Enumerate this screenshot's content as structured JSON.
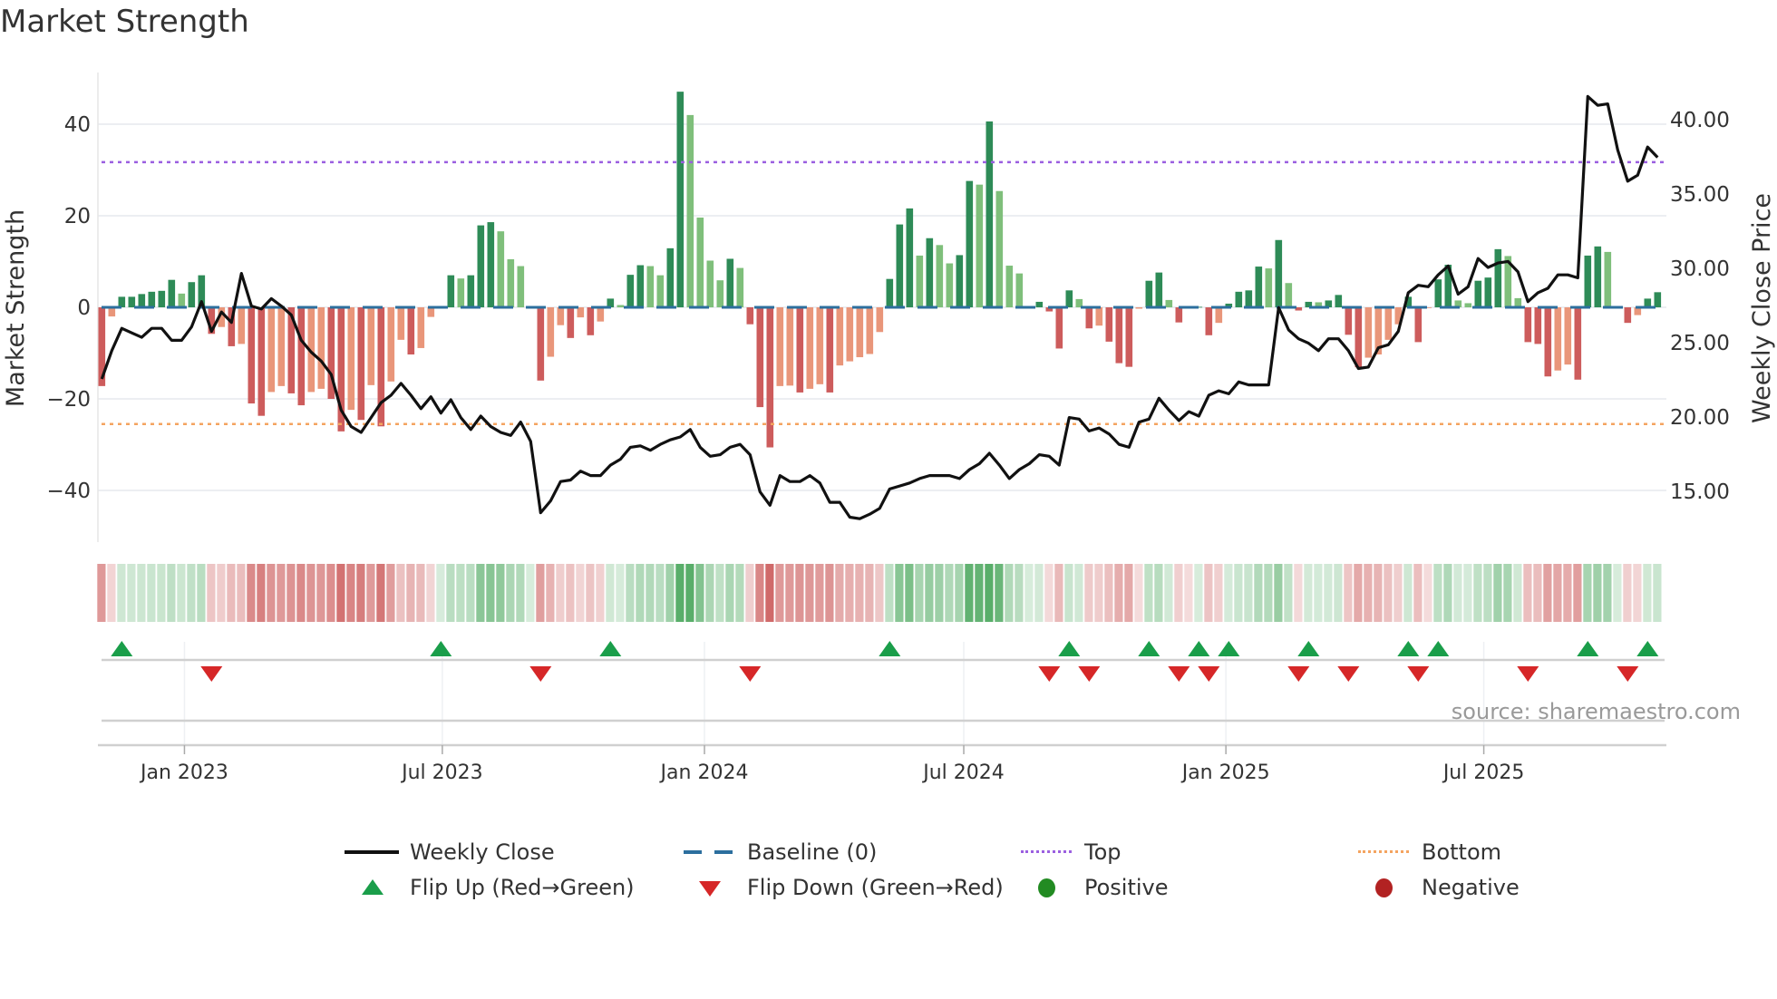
{
  "title": "Market Strength",
  "source": "source: sharemaestro.com",
  "colors": {
    "strength_up_strong": "#2e8b57",
    "strength_up_weak": "#7fbf7b",
    "strength_down_strong": "#cd5c5c",
    "strength_down_weak": "#e9967a",
    "weekly_close": "#111111",
    "baseline": "#2c6f9e",
    "top": "#9b5fe0",
    "bottom": "#f4a460",
    "flip_up": "#1a9e4a",
    "flip_down": "#d62728",
    "positive": "#228b22",
    "negative": "#b22222"
  },
  "legend": [
    {
      "label": "Weekly Close",
      "symbol": "solid-line"
    },
    {
      "label": "Baseline (0)",
      "symbol": "dashed-line"
    },
    {
      "label": "Top",
      "symbol": "dotted-line"
    },
    {
      "label": "Bottom",
      "symbol": "dotted-line"
    },
    {
      "label": "Flip Up (Red→Green)",
      "symbol": "triangle-up"
    },
    {
      "label": "Flip Down (Green→Red)",
      "symbol": "triangle-down"
    },
    {
      "label": "Positive",
      "symbol": "circle"
    },
    {
      "label": "Negative",
      "symbol": "circle"
    }
  ],
  "chart_data": {
    "type": "bar",
    "title": "Market Strength",
    "ylabel": "Market Strength",
    "y2label": "Weekly Close Price",
    "ylim": [
      -51,
      52
    ],
    "y2lim": [
      11.5,
      43
    ],
    "yticks": [
      40,
      20,
      0,
      -20,
      -40
    ],
    "ytick_labels": [
      "40",
      "20",
      "0",
      "−20",
      "−40"
    ],
    "y2ticks": [
      40,
      35,
      30,
      25,
      20,
      15
    ],
    "y2tick_labels": [
      "40.00",
      "35.00",
      "30.00",
      "25.00",
      "20.00",
      "15.00"
    ],
    "xticks": [
      "2023-01-01",
      "2023-07-01",
      "2024-01-01",
      "2024-07-01",
      "2025-01-01",
      "2025-07-01"
    ],
    "xtick_labels": [
      "Jan 2023",
      "Jul 2023",
      "Jan 2024",
      "Jul 2024",
      "Jan 2025",
      "Jul 2025"
    ],
    "grid": true,
    "legend_position": "bottom",
    "top_level": 31.7,
    "bottom_level": -25.5,
    "baseline": 0,
    "dates": [
      "2022-11-04",
      "2022-11-11",
      "2022-11-18",
      "2022-11-25",
      "2022-12-02",
      "2022-12-09",
      "2022-12-16",
      "2022-12-23",
      "2022-12-30",
      "2023-01-06",
      "2023-01-13",
      "2023-01-20",
      "2023-01-27",
      "2023-02-03",
      "2023-02-10",
      "2023-02-17",
      "2023-02-24",
      "2023-03-03",
      "2023-03-10",
      "2023-03-17",
      "2023-03-24",
      "2023-03-31",
      "2023-04-07",
      "2023-04-14",
      "2023-04-21",
      "2023-04-28",
      "2023-05-05",
      "2023-05-12",
      "2023-05-19",
      "2023-05-26",
      "2023-06-02",
      "2023-06-09",
      "2023-06-16",
      "2023-06-23",
      "2023-06-30",
      "2023-07-07",
      "2023-07-14",
      "2023-07-21",
      "2023-07-28",
      "2023-08-04",
      "2023-08-11",
      "2023-08-18",
      "2023-08-25",
      "2023-09-01",
      "2023-09-08",
      "2023-09-15",
      "2023-09-22",
      "2023-09-29",
      "2023-10-06",
      "2023-10-13",
      "2023-10-20",
      "2023-10-27",
      "2023-11-03",
      "2023-11-10",
      "2023-11-17",
      "2023-11-24",
      "2023-12-01",
      "2023-12-08",
      "2023-12-15",
      "2023-12-22",
      "2023-12-29",
      "2024-01-05",
      "2024-01-12",
      "2024-01-19",
      "2024-01-26",
      "2024-02-02",
      "2024-02-09",
      "2024-02-16",
      "2024-02-23",
      "2024-03-01",
      "2024-03-08",
      "2024-03-15",
      "2024-03-22",
      "2024-03-29",
      "2024-04-05",
      "2024-04-12",
      "2024-04-19",
      "2024-04-26",
      "2024-05-03",
      "2024-05-10",
      "2024-05-17",
      "2024-05-24",
      "2024-05-31",
      "2024-06-07",
      "2024-06-14",
      "2024-06-21",
      "2024-06-28",
      "2024-07-05",
      "2024-07-12",
      "2024-07-19",
      "2024-07-26",
      "2024-08-02",
      "2024-08-09",
      "2024-08-16",
      "2024-08-23",
      "2024-08-30",
      "2024-09-06",
      "2024-09-13",
      "2024-09-20",
      "2024-09-27",
      "2024-10-04",
      "2024-10-11",
      "2024-10-18",
      "2024-10-25",
      "2024-11-01",
      "2024-11-08",
      "2024-11-15",
      "2024-11-22",
      "2024-11-29",
      "2024-12-06",
      "2024-12-13",
      "2024-12-20",
      "2024-12-27",
      "2025-01-03",
      "2025-01-10",
      "2025-01-17",
      "2025-01-24",
      "2025-01-31",
      "2025-02-07",
      "2025-02-14",
      "2025-02-21",
      "2025-02-28",
      "2025-03-07",
      "2025-03-14",
      "2025-03-21",
      "2025-03-28",
      "2025-04-04",
      "2025-04-11",
      "2025-04-18",
      "2025-04-25",
      "2025-05-02",
      "2025-05-09",
      "2025-05-16",
      "2025-05-23",
      "2025-05-30",
      "2025-06-06",
      "2025-06-13",
      "2025-06-20",
      "2025-06-27",
      "2025-07-04",
      "2025-07-11",
      "2025-07-18",
      "2025-07-25",
      "2025-08-01",
      "2025-08-08",
      "2025-08-15",
      "2025-08-22",
      "2025-08-29",
      "2025-09-05",
      "2025-09-12",
      "2025-09-19",
      "2025-09-26",
      "2025-10-03",
      "2025-10-10",
      "2025-10-17",
      "2025-10-24",
      "2025-10-31"
    ],
    "series": [
      {
        "name": "Market Strength",
        "axis": "left",
        "kind": "bar",
        "values": [
          -17.2,
          -2,
          2.3,
          2.3,
          2.9,
          3.4,
          3.6,
          6,
          3,
          5.5,
          7,
          -5.8,
          -4.3,
          -8.5,
          -8,
          -21,
          -23.7,
          -18.5,
          -17.2,
          -18.8,
          -21.4,
          -18.5,
          -17.8,
          -20,
          -27.1,
          -22.4,
          -24.6,
          -17,
          -26,
          -16.2,
          -7.1,
          -10.3,
          -8.9,
          -2.1,
          0.3,
          7,
          6.3,
          7,
          17.9,
          18.6,
          16.6,
          10.5,
          9,
          0.2,
          -16,
          -10.8,
          -3.9,
          -6.7,
          -2.2,
          -6.1,
          -3.1,
          1.9,
          0.5,
          7.1,
          9.2,
          9,
          7,
          12.9,
          47.1,
          42,
          19.6,
          10.2,
          5.9,
          10.6,
          8.6,
          -3.7,
          -21.8,
          -30.6,
          -17.2,
          -17.1,
          -18.6,
          -17.8,
          -16.8,
          -18.6,
          -12.7,
          -11.8,
          -10.9,
          -10.2,
          -5.4,
          6.2,
          18.1,
          21.6,
          11.3,
          15.1,
          13.6,
          9.6,
          11.4,
          27.6,
          26.8,
          40.6,
          25.4,
          9.1,
          7.4,
          0.1,
          1.2,
          -0.9,
          -9,
          3.7,
          1.8,
          -4.6,
          -4,
          -7.5,
          -12.2,
          -13,
          -0.3,
          5.8,
          7.6,
          1.6,
          -3.3,
          -0.1,
          0.1,
          -6.1,
          -3.4,
          0.8,
          3.4,
          3.7,
          8.9,
          8.5,
          14.7,
          5.3,
          -0.7,
          1.2,
          1.1,
          1.5,
          2.7,
          -6,
          -13.1,
          -11,
          -10.3,
          -7.1,
          -3.7,
          2.3,
          -7.6,
          -0.1,
          6.1,
          9.3,
          1.5,
          0.9,
          5.8,
          6.5,
          12.7,
          11.2,
          2,
          -7.6,
          -8,
          -15.1,
          -13.8,
          -12.5,
          -15.8,
          11.3,
          13.3,
          12.1,
          0.1,
          -3.4,
          -1.7,
          1.9,
          3.3
        ]
      },
      {
        "name": "Weekly Close",
        "axis": "right",
        "kind": "line",
        "values": [
          22.5,
          24.4,
          25.9,
          25.6,
          25.3,
          25.9,
          25.9,
          25.1,
          25.1,
          26.0,
          27.7,
          25.7,
          27.0,
          26.3,
          29.6,
          27.4,
          27.2,
          27.9,
          27.4,
          26.8,
          25.1,
          24.3,
          23.7,
          22.8,
          20.4,
          19.3,
          18.9,
          19.9,
          20.9,
          21.4,
          22.2,
          21.4,
          20.5,
          21.3,
          20.2,
          21.1,
          19.9,
          19.1,
          20.0,
          19.3,
          18.9,
          18.7,
          19.6,
          18.3,
          13.5,
          14.3,
          15.6,
          15.7,
          16.3,
          16.0,
          16.0,
          16.7,
          17.1,
          17.9,
          18.0,
          17.7,
          18.1,
          18.4,
          18.6,
          19.1,
          17.9,
          17.3,
          17.4,
          17.9,
          18.1,
          17.4,
          14.9,
          14.0,
          16.0,
          15.6,
          15.6,
          16.0,
          15.5,
          14.2,
          14.2,
          13.2,
          13.1,
          13.4,
          13.8,
          15.1,
          15.3,
          15.5,
          15.8,
          16.0,
          16.0,
          16.0,
          15.8,
          16.4,
          16.8,
          17.5,
          16.7,
          15.8,
          16.4,
          16.8,
          17.4,
          17.3,
          16.7,
          19.9,
          19.8,
          19.0,
          19.2,
          18.8,
          18.1,
          17.9,
          19.6,
          19.8,
          21.2,
          20.4,
          19.7,
          20.3,
          20.0,
          21.4,
          21.7,
          21.5,
          22.3,
          22.1,
          22.1,
          22.1,
          27.3,
          25.8,
          25.2,
          24.9,
          24.4,
          25.2,
          25.2,
          24.4,
          23.2,
          23.3,
          24.6,
          24.8,
          25.7,
          28.3,
          28.8,
          28.7,
          29.5,
          30.1,
          28.2,
          28.7,
          30.6,
          30.0,
          30.3,
          30.4,
          29.7,
          27.7,
          28.3,
          28.6,
          29.5,
          29.5,
          29.3,
          41.5,
          40.9,
          41.0,
          37.9,
          35.8,
          36.2,
          38.1,
          37.4
        ]
      }
    ],
    "flip_up": [
      "2022-11-18",
      "2023-06-30",
      "2023-10-27",
      "2024-05-10",
      "2024-09-13",
      "2024-11-08",
      "2024-12-13",
      "2025-01-03",
      "2025-02-28",
      "2025-05-09",
      "2025-05-30",
      "2025-09-12",
      "2025-10-24"
    ],
    "flip_down": [
      "2023-01-20",
      "2023-09-08",
      "2024-02-02",
      "2024-08-30",
      "2024-09-27",
      "2024-11-29",
      "2024-12-20",
      "2025-02-21",
      "2025-03-28",
      "2025-05-16",
      "2025-08-01",
      "2025-10-10"
    ]
  }
}
